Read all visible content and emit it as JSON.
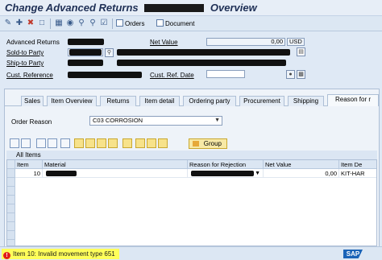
{
  "title": {
    "left": "Change Advanced Returns",
    "right": "Overview"
  },
  "toolbar": {
    "orders_label": "Orders",
    "document_label": "Document"
  },
  "header": {
    "advanced_returns_label": "Advanced Returns",
    "net_value_label": "Net Value",
    "net_value": "0,00",
    "currency": "USD",
    "sold_to_label": "Sold-to Party",
    "ship_to_label": "Ship-to Party",
    "cust_reference_label": "Cust. Reference",
    "cust_ref_date_label": "Cust. Ref. Date"
  },
  "tabs": [
    "Sales",
    "Item Overview",
    "Returns",
    "Item detail",
    "Ordering party",
    "Procurement",
    "Shipping",
    "Reason for r"
  ],
  "active_tab_index": 7,
  "order_reason": {
    "label": "Order Reason",
    "value": "C03 CORROSION"
  },
  "group_button_label": "Group",
  "all_items_label": "All Items",
  "grid": {
    "headers": [
      "Item",
      "Material",
      "Reason for Rejection",
      "Net Value",
      "Item De"
    ],
    "rows": [
      {
        "item": "10",
        "material": "",
        "reason": "",
        "net_value": "0,00",
        "item_desc": "KIT-HAR"
      }
    ]
  },
  "status": {
    "message": "Item 10: Invalid movement type 651"
  },
  "brand": "SAP"
}
